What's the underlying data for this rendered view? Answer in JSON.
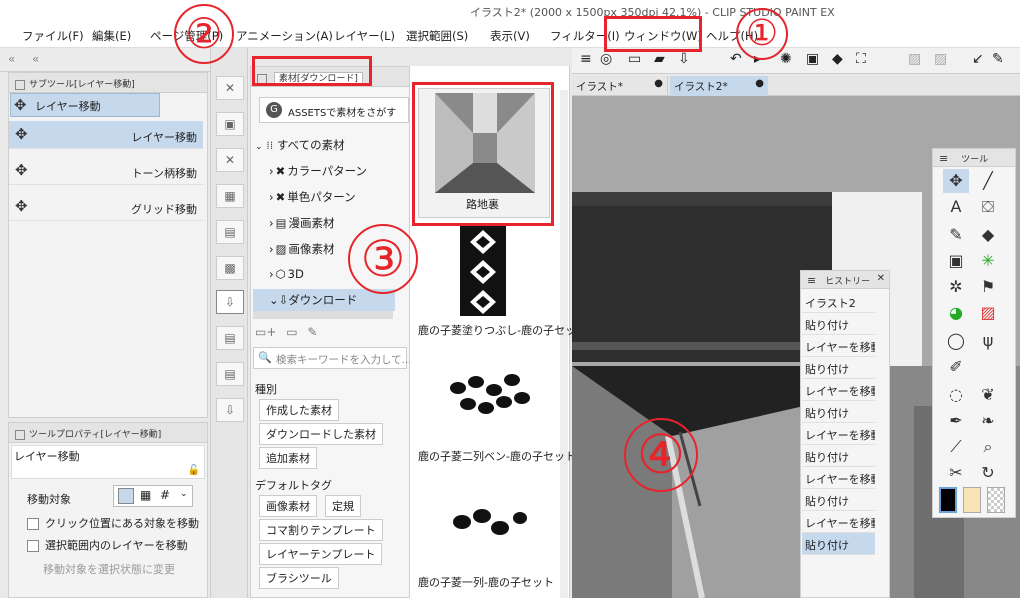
{
  "window_title": "イラスト2* (2000 x 1500px 350dpi 42.1%)  - CLIP STUDIO PAINT EX",
  "menu": [
    {
      "label": "ファイル(F)"
    },
    {
      "label": "編集(E)"
    },
    {
      "label": "ページ管理(P)"
    },
    {
      "label": "アニメーション(A)"
    },
    {
      "label": "レイヤー(L)"
    },
    {
      "label": "選択範囲(S)"
    },
    {
      "label": "表示(V)"
    },
    {
      "label": "フィルター(I)"
    },
    {
      "label": "ウィンドウ(W)"
    },
    {
      "label": "ヘルプ(H)"
    }
  ],
  "subtool": {
    "header": "サブツール[レイヤー移動]",
    "selected": "レイヤー移動",
    "items": [
      {
        "label": "レイヤー移動"
      },
      {
        "label": "トーン柄移動"
      },
      {
        "label": "グリッド移動"
      }
    ]
  },
  "tool_property": {
    "header": "ツールプロパティ[レイヤー移動]",
    "title": "レイヤー移動",
    "target_label": "移動対象",
    "options": [
      {
        "label": "クリック位置にある対象を移動"
      },
      {
        "label": "選択範囲内のレイヤーを移動"
      },
      {
        "label": "移動対象を選択状態に変更"
      }
    ]
  },
  "material": {
    "tab": "素材[ダウンロード]",
    "assets_button": "ASSETSで素材をさがす",
    "tree": [
      {
        "label": "すべての素材"
      },
      {
        "label": "カラーパターン"
      },
      {
        "label": "単色パターン"
      },
      {
        "label": "漫画素材"
      },
      {
        "label": "画像素材"
      },
      {
        "label": "3D"
      },
      {
        "label": "ダウンロード"
      }
    ],
    "search_placeholder": "検索キーワードを入力して...",
    "kind_label": "種別",
    "kind_tags": [
      "作成した素材",
      "ダウンロードした素材",
      "追加素材"
    ],
    "default_tag_label": "デフォルトタグ",
    "default_tags": [
      "画像素材",
      "定規",
      "コマ割りテンプレート",
      "レイヤーテンプレート",
      "ブラシツール"
    ],
    "items": [
      {
        "label": "路地裏"
      },
      {
        "label": "鹿の子菱塗りつぶし-鹿の子セット"
      },
      {
        "label": "鹿の子菱二列ベン-鹿の子セット"
      },
      {
        "label": "鹿の子菱一列-鹿の子セット"
      }
    ]
  },
  "canvas_tabs": [
    {
      "label": "イラスト*"
    },
    {
      "label": "イラスト2*"
    }
  ],
  "history": {
    "title": "ヒストリー",
    "items": [
      {
        "label": "イラスト2"
      },
      {
        "label": "貼り付け"
      },
      {
        "label": "レイヤーを移動"
      },
      {
        "label": "貼り付け"
      },
      {
        "label": "レイヤーを移動"
      },
      {
        "label": "貼り付け"
      },
      {
        "label": "レイヤーを移動"
      },
      {
        "label": "貼り付け"
      },
      {
        "label": "レイヤーを移動"
      },
      {
        "label": "貼り付け"
      },
      {
        "label": "レイヤーを移動"
      },
      {
        "label": "貼り付け"
      }
    ]
  },
  "tool_palette": {
    "title": "ツール"
  },
  "annotations": [
    "①",
    "②",
    "③",
    "④"
  ],
  "colors": {
    "annotation_red": "#e6242b",
    "selection_blue": "#c5d8ec"
  }
}
